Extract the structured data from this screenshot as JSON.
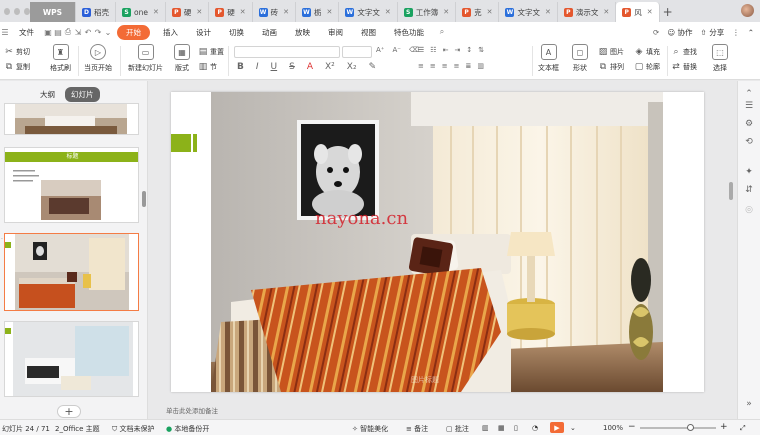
{
  "tabs": [
    {
      "label": "WPS",
      "type": "wps"
    },
    {
      "label": "稻壳",
      "icon": "D",
      "color": "#2b5fd9"
    },
    {
      "label": "one",
      "icon": "S",
      "color": "#1aa260",
      "close": true
    },
    {
      "label": "硬",
      "icon": "P",
      "color": "#e4572e",
      "close": true
    },
    {
      "label": "硬",
      "icon": "P",
      "color": "#e4572e",
      "close": true
    },
    {
      "label": "砖",
      "icon": "W",
      "color": "#2b6fdb",
      "close": true
    },
    {
      "label": "栃",
      "icon": "W",
      "color": "#2b6fdb",
      "close": true
    },
    {
      "label": "文字文",
      "icon": "W",
      "color": "#2b6fdb",
      "close": true
    },
    {
      "label": "工作簿",
      "icon": "S",
      "color": "#1aa260",
      "close": true
    },
    {
      "label": "克",
      "icon": "P",
      "color": "#e4572e",
      "close": true
    },
    {
      "label": "文字文",
      "icon": "W",
      "color": "#2b6fdb",
      "close": true
    },
    {
      "label": "演示文",
      "icon": "P",
      "color": "#e4572e",
      "close": true
    },
    {
      "label": "风",
      "icon": "P",
      "color": "#e4572e",
      "close": true,
      "active": true
    }
  ],
  "menu": {
    "file": "文件",
    "items": [
      "开始",
      "插入",
      "设计",
      "切换",
      "动画",
      "放映",
      "审阅",
      "视图",
      "特色功能"
    ],
    "collab": "协作",
    "share": "分享"
  },
  "ribbon": {
    "cut": "剪切",
    "copy": "复制",
    "format_painter": "格式刷",
    "from_current": "当页开始",
    "new_slide": "新建幻灯片",
    "layout": "版式",
    "reset": "重置",
    "section": "节",
    "textbox": "文本框",
    "shape": "形状",
    "arrange": "排列",
    "picture": "图片",
    "fill": "填充",
    "outline": "轮廓",
    "find": "查找",
    "replace": "替换",
    "select": "选择",
    "bold": "B",
    "italic": "I",
    "underline": "U",
    "strike": "S"
  },
  "left_panel": {
    "outline_tab": "大纲",
    "slides_tab": "幻灯片",
    "slide2_title": "标题"
  },
  "slide": {
    "watermark": "nayona.cn",
    "caption": "图片标题"
  },
  "notes_placeholder": "单击此处添加备注",
  "status": {
    "slide_info": "幻灯片 24 / 71",
    "theme": "2_Office 主题",
    "protect": "文档未保护",
    "backup": "本地备份开",
    "beautify": "智能美化",
    "notes": "备注",
    "comments": "批注",
    "zoom": "100%"
  },
  "colors": {
    "accent_orange": "#f36b36",
    "slide_green": "#8cb219",
    "selected_border": "#f47c45"
  }
}
